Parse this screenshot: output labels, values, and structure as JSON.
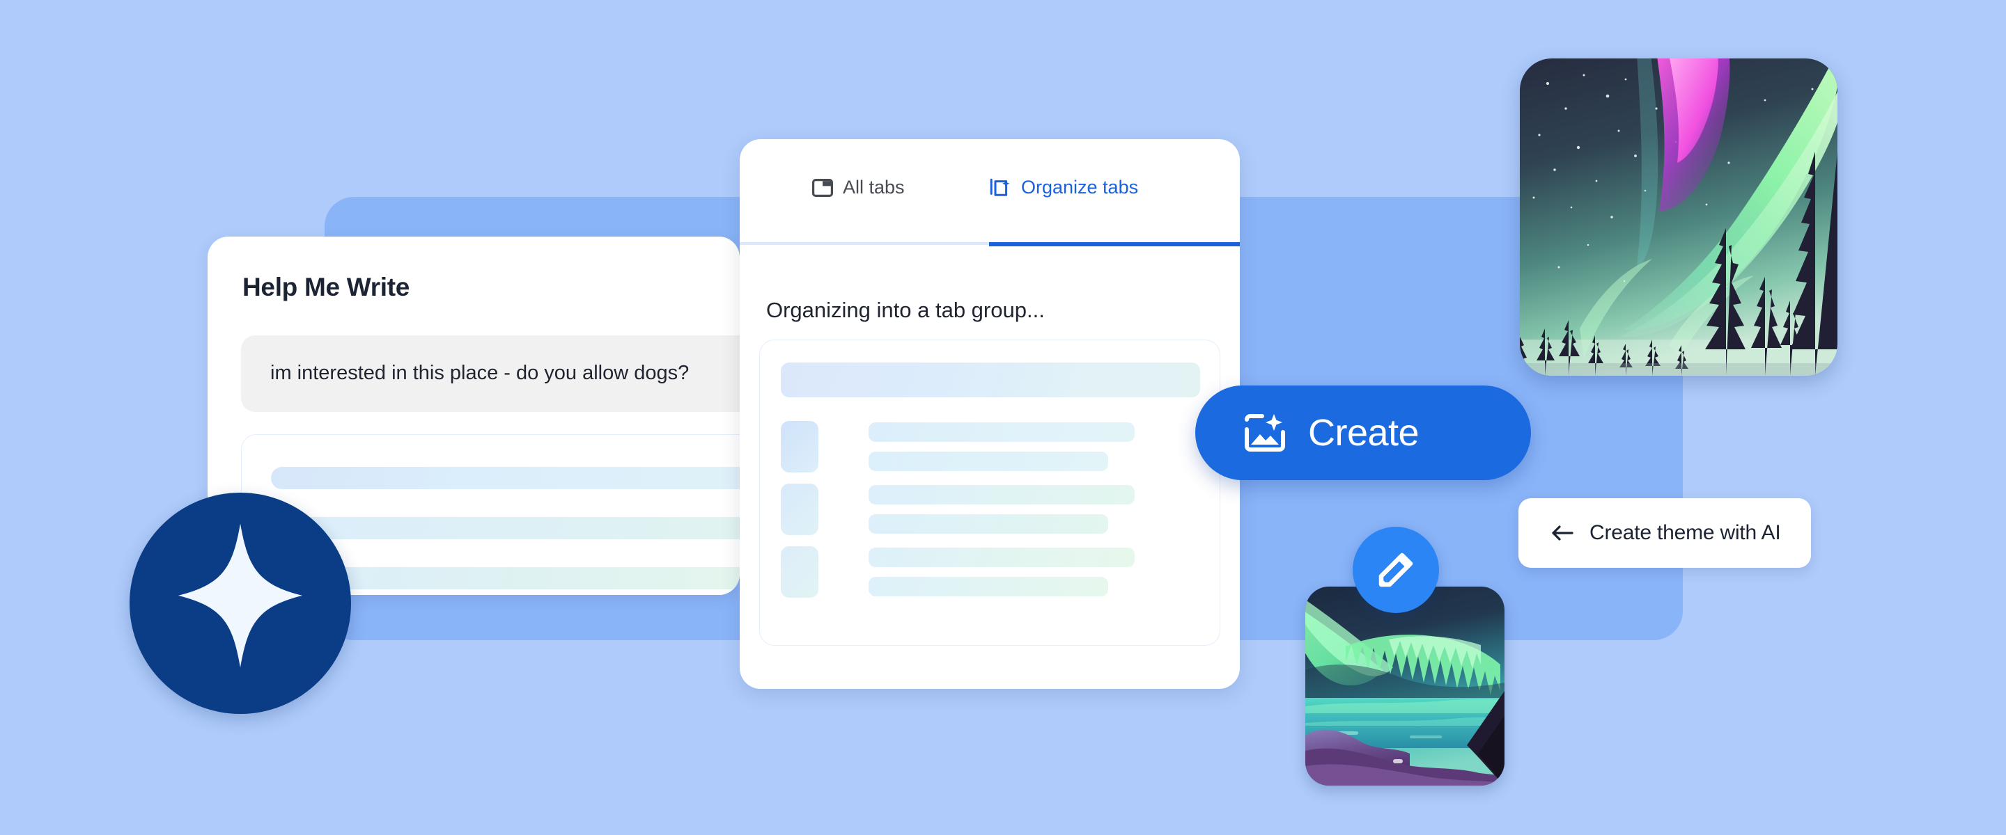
{
  "background": {
    "page_color": "#aecbfb",
    "panel_color": "#8ab4f8"
  },
  "help_me_write": {
    "title": "Help Me Write",
    "prompt_text": "im interested in this place - do you allow dogs?",
    "output_placeholder_lines": 3
  },
  "organize_panel": {
    "tabs": [
      {
        "label": "All tabs",
        "icon": "browser-window-icon",
        "active": false
      },
      {
        "label": "Organize tabs",
        "icon": "stacked-pages-sparkle-icon",
        "active": true
      }
    ],
    "heading": "Organizing into a tab group...",
    "active_tab_color": "#1a62dd",
    "group_rows": 3
  },
  "gemini_badge": {
    "icon": "four-point-star-icon",
    "circle_color": "#0b3d87",
    "star_color": "#f1f7fe"
  },
  "create_button": {
    "label": "Create",
    "icon": "image-sparkle-icon",
    "color": "#1b6ae0"
  },
  "edit_fab": {
    "icon": "pencil-icon",
    "color": "#2c85f5"
  },
  "theme_chip": {
    "label": "Create theme with AI",
    "icon": "arrow-left-icon"
  },
  "thumbnails": [
    {
      "name": "aurora-forest-theme-preview",
      "alt": "Aurora borealis over pine forest"
    },
    {
      "name": "aurora-lake-theme-preview",
      "alt": "Aurora borealis over mountain lake"
    }
  ]
}
